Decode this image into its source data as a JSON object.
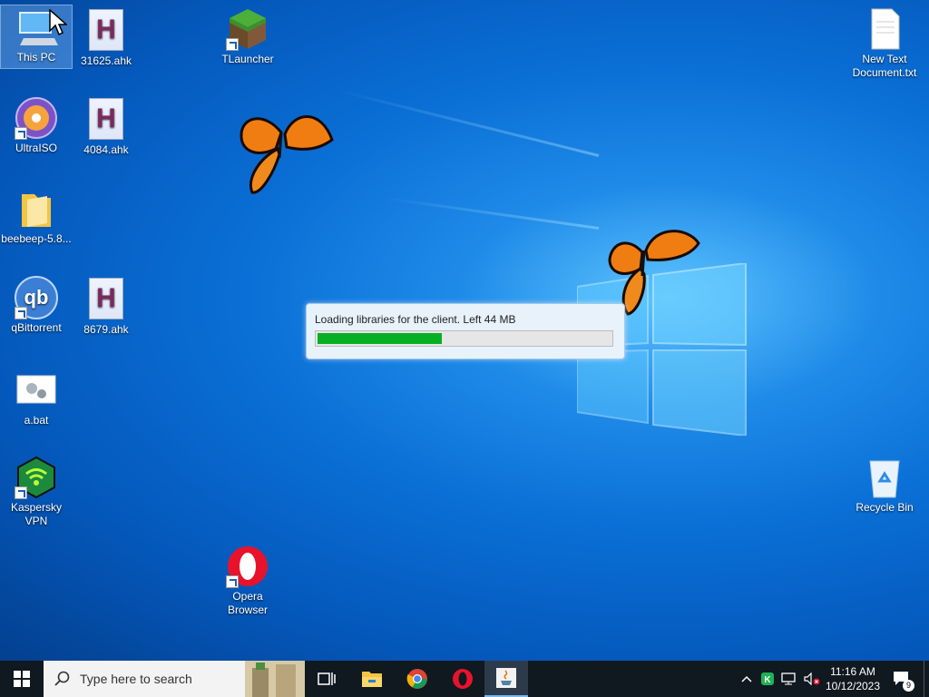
{
  "desktop_icons": {
    "this_pc": "This PC",
    "ahk_31625": "31625.ahk",
    "tlauncher": "TLauncher",
    "new_text_doc": "New Text Document.txt",
    "ultraiso": "UltraISO",
    "ahk_4084": "4084.ahk",
    "beebeep": "beebeep-5.8...",
    "qbittorrent": "qBittorrent",
    "ahk_8679": "8679.ahk",
    "a_bat": "a.bat",
    "kaspersky": "Kaspersky VPN",
    "opera": "Opera Browser",
    "recycle_bin": "Recycle Bin"
  },
  "loader": {
    "message": "Loading libraries for the client. Left 44 MB",
    "progress": 0.43
  },
  "taskbar": {
    "search_placeholder": "Type here to search",
    "time": "11:16 AM",
    "date": "10/12/2023",
    "notification_count": "9"
  },
  "colors": {
    "progress_fill": "#06b025",
    "taskbar": "#101820",
    "desktop_accent": "#0a6fd6"
  }
}
